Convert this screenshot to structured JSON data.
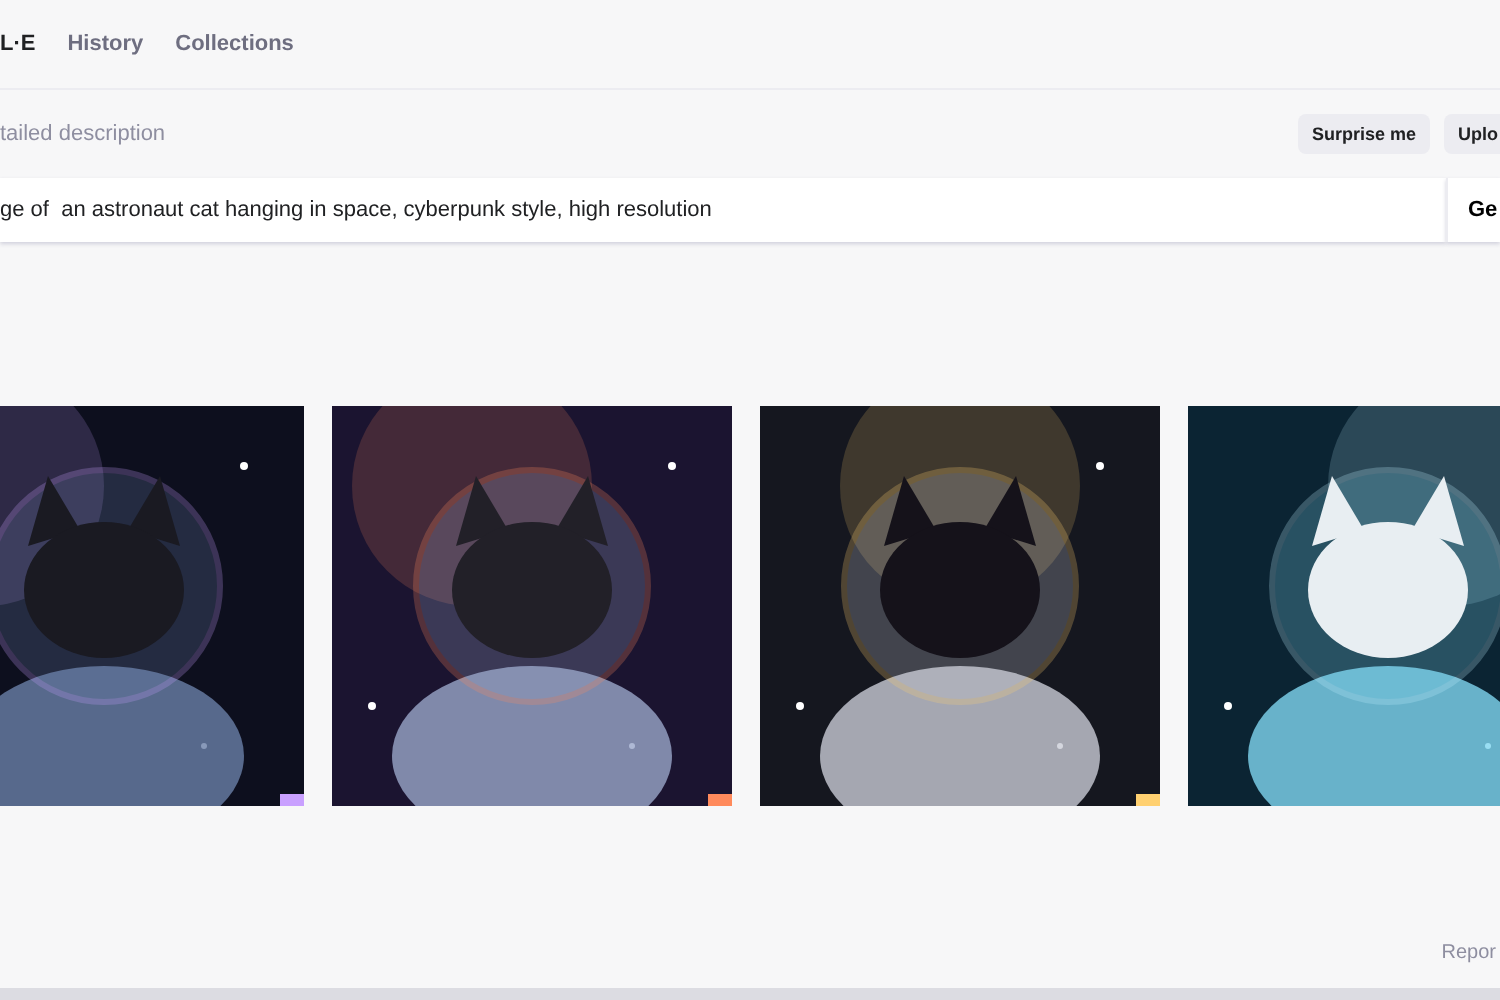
{
  "nav": {
    "logo": "L·E",
    "links": [
      {
        "label": "History"
      },
      {
        "label": "Collections"
      }
    ]
  },
  "prompt": {
    "label": "tailed description",
    "buttons": [
      "Surprise me",
      "Uplo"
    ],
    "value": "ge of  an astronaut cat hanging in space, cyberpunk style, high resolution",
    "submit": "Ge"
  },
  "footer": {
    "link": "Repor"
  }
}
